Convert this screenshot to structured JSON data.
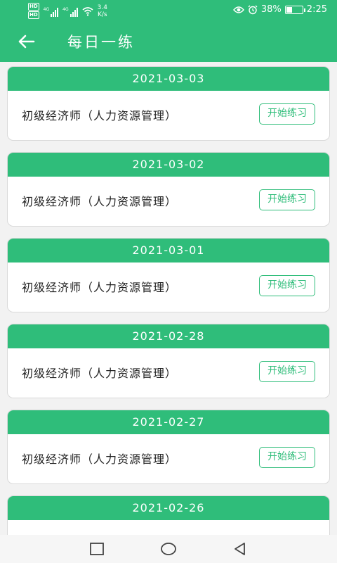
{
  "status_bar": {
    "hd_badges": [
      "HD",
      "HD"
    ],
    "signal_labels": [
      "4G",
      "4G"
    ],
    "speed_value": "3.4",
    "speed_unit": "K/s",
    "battery_percent": "38%",
    "battery_level": 0.38,
    "time": "2:25",
    "icons": [
      "eye-icon",
      "alarm-icon",
      "battery-icon",
      "wifi-icon",
      "signal-icon"
    ]
  },
  "app_bar": {
    "title": "每日一练",
    "back_icon": "arrow-left-icon"
  },
  "practice_list": [
    {
      "date": "2021-03-03",
      "title": "初级经济师（人力资源管理）",
      "button": "开始练习"
    },
    {
      "date": "2021-03-02",
      "title": "初级经济师（人力资源管理）",
      "button": "开始练习"
    },
    {
      "date": "2021-03-01",
      "title": "初级经济师（人力资源管理）",
      "button": "开始练习"
    },
    {
      "date": "2021-02-28",
      "title": "初级经济师（人力资源管理）",
      "button": "开始练习"
    },
    {
      "date": "2021-02-27",
      "title": "初级经济师（人力资源管理）",
      "button": "开始练习"
    },
    {
      "date": "2021-02-26",
      "title": "",
      "button": ""
    }
  ],
  "nav_bar": {
    "icons": [
      "recents-square-icon",
      "home-circle-icon",
      "back-triangle-icon"
    ]
  },
  "colors": {
    "primary": "#2fbd7a",
    "card_border": "#d9d9d9",
    "background": "#f2f2f2",
    "text": "#222222"
  }
}
